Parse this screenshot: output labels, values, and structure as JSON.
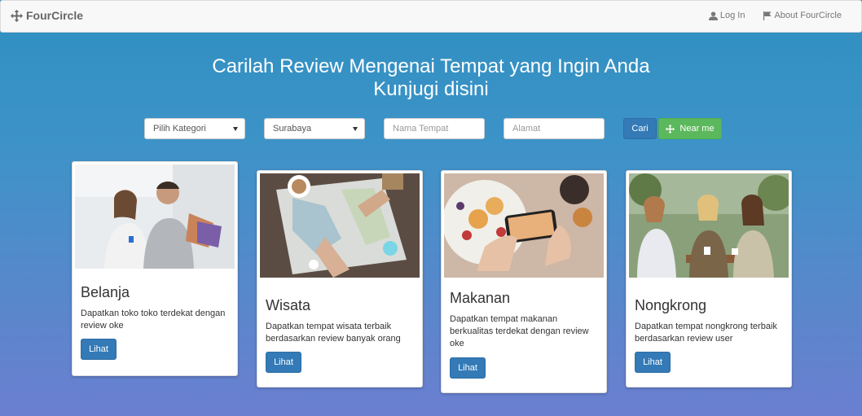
{
  "navbar": {
    "brand": "FourCircle",
    "brand_icon": "move-icon",
    "links": [
      {
        "label": "Log In",
        "icon": "user-icon"
      },
      {
        "label": "About FourCircle",
        "icon": "flag-icon"
      }
    ]
  },
  "hero": {
    "line1": "Carilah Review Mengenai Tempat yang Ingin Anda",
    "line2": "Kunjugi disini"
  },
  "search": {
    "category_selected": "Pilih Kategori",
    "city_selected": "Surabaya",
    "name_placeholder": "Nama Tempat",
    "address_placeholder": "Alamat",
    "search_label": "Cari",
    "near_label": "Near me"
  },
  "cards": [
    {
      "title": "Belanja",
      "text": "Dapatkan toko toko terdekat dengan review oke",
      "button": "Lihat"
    },
    {
      "title": "Wisata",
      "text": "Dapatkan tempat wisata terbaik berdasarkan review banyak orang",
      "button": "Lihat"
    },
    {
      "title": "Makanan",
      "text": "Dapatkan tempat makanan berkualitas terdekat dengan review oke",
      "button": "Lihat"
    },
    {
      "title": "Nongkrong",
      "text": "Dapatkan tempat nongkrong terbaik berdasarkan review user",
      "button": "Lihat"
    }
  ],
  "colors": {
    "primary": "#337ab7",
    "success": "#5cb85c"
  }
}
